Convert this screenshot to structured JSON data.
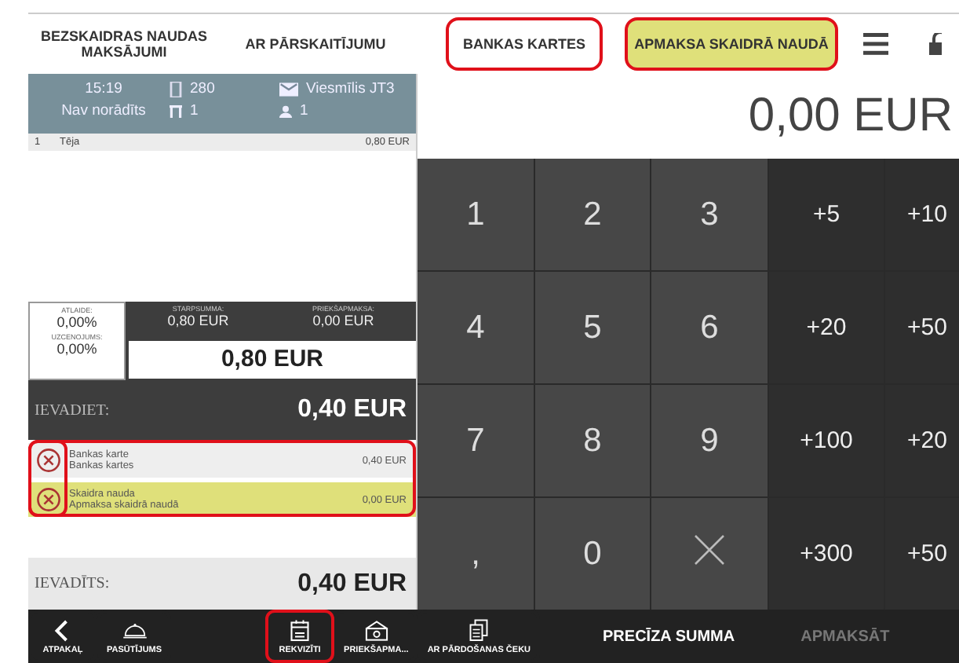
{
  "top_tabs": [
    {
      "label": "BEZSKAIDRAS NAUDAS MAKSĀJUMI",
      "selected": false,
      "highlighted": false
    },
    {
      "label": "AR PĀRSKAITĪJUMU",
      "selected": false,
      "highlighted": false
    },
    {
      "label": "BANKAS KARTES",
      "selected": false,
      "highlighted": true
    },
    {
      "label": "APMAKSA SKAIDRĀ NAUDĀ",
      "selected": true,
      "highlighted": true
    }
  ],
  "info": {
    "time": "15:19",
    "client": "Nav norādīts",
    "receipt": "280",
    "table": "1",
    "waiter": "Viesmīlis JT3",
    "guests": "1"
  },
  "order_rows": [
    {
      "number": "1",
      "name": "Tēja",
      "amount": "0,80 EUR"
    }
  ],
  "totals": {
    "discount_label": "ATLAIDE:",
    "discount": "0,00%",
    "markup_label": "UZCENOJUMS:",
    "markup": "0,00%",
    "subtotal_label": "STARPSUMMA:",
    "subtotal": "0,80 EUR",
    "prepayment_label": "PRIEKŠAPMAKSA:",
    "prepayment": "0,00 EUR",
    "total": "0,80 EUR"
  },
  "enter": {
    "label": "IEVADIET:",
    "amount": "0,40 EUR"
  },
  "payments": [
    {
      "name": "Bankas karte",
      "description": "Bankas kartes",
      "amount": "0,40 EUR",
      "selected": false
    },
    {
      "name": "Skaidra nauda",
      "description": "Apmaksa skaidrā naudā",
      "amount": "0,00 EUR",
      "selected": true
    }
  ],
  "payments_highlighted": true,
  "remove_column_highlighted": true,
  "entered": {
    "label": "IEVADĪTS:",
    "amount": "0,40 EUR"
  },
  "display": "0,00 EUR",
  "keypad": [
    {
      "label": "1",
      "kind": "digit"
    },
    {
      "label": "2",
      "kind": "digit"
    },
    {
      "label": "3",
      "kind": "digit"
    },
    {
      "label": "+5",
      "kind": "quick"
    },
    {
      "label": "+10",
      "kind": "quick"
    },
    {
      "label": "4",
      "kind": "digit"
    },
    {
      "label": "5",
      "kind": "digit"
    },
    {
      "label": "6",
      "kind": "digit"
    },
    {
      "label": "+20",
      "kind": "quick"
    },
    {
      "label": "+50",
      "kind": "quick"
    },
    {
      "label": "7",
      "kind": "digit"
    },
    {
      "label": "8",
      "kind": "digit"
    },
    {
      "label": "9",
      "kind": "digit"
    },
    {
      "label": "+100",
      "kind": "quick"
    },
    {
      "label": "+20",
      "kind": "quick"
    },
    {
      "label": ",",
      "kind": "digit"
    },
    {
      "label": "0",
      "kind": "digit"
    },
    {
      "kind": "clear"
    },
    {
      "label": "+300",
      "kind": "quick"
    },
    {
      "label": "+50",
      "kind": "quick"
    }
  ],
  "bottom_bar": [
    {
      "label": "ATPAKAĻ",
      "kind": "back",
      "highlighted": false
    },
    {
      "label": "PASŪTĪJUMS",
      "kind": "order",
      "highlighted": false
    },
    {
      "label": "REKVIZĪTI",
      "kind": "details",
      "highlighted": true
    },
    {
      "label": "PRIEKŠAPMA...",
      "kind": "prepay",
      "highlighted": false
    },
    {
      "label": "AR PĀRDOŠANAS ČEKU",
      "kind": "receipt",
      "highlighted": false
    },
    {
      "label": "PRECĪZA SUMMA",
      "kind": "text",
      "disabled": false
    },
    {
      "label": "APMAKSĀT",
      "kind": "text",
      "disabled": true
    }
  ]
}
